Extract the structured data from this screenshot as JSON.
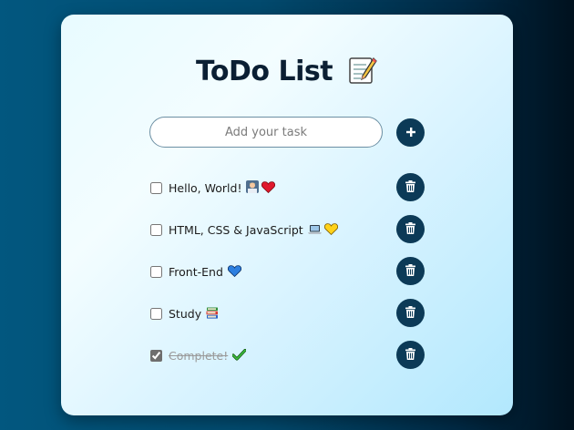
{
  "app": {
    "title": "ToDo List",
    "title_icon": "memo-icon"
  },
  "input": {
    "placeholder": "Add your task",
    "value": ""
  },
  "add_button": {
    "icon": "plus-icon"
  },
  "tasks": [
    {
      "label": "Hello, World!",
      "checked": false,
      "emoji": [
        "technologist-icon",
        "red-heart-icon"
      ]
    },
    {
      "label": "HTML, CSS & JavaScript",
      "checked": false,
      "emoji": [
        "laptop-icon",
        "yellow-heart-icon"
      ]
    },
    {
      "label": "Front-End",
      "checked": false,
      "emoji": [
        "blue-heart-icon"
      ]
    },
    {
      "label": "Study",
      "checked": false,
      "emoji": [
        "books-icon"
      ]
    },
    {
      "label": "Complete!",
      "checked": true,
      "emoji": [
        "check-mark-icon"
      ]
    }
  ],
  "delete_button": {
    "icon": "trash-icon"
  },
  "colors": {
    "accent": "#0c3a57",
    "title": "#0b1f33",
    "completed_text": "#9a9a9a"
  }
}
